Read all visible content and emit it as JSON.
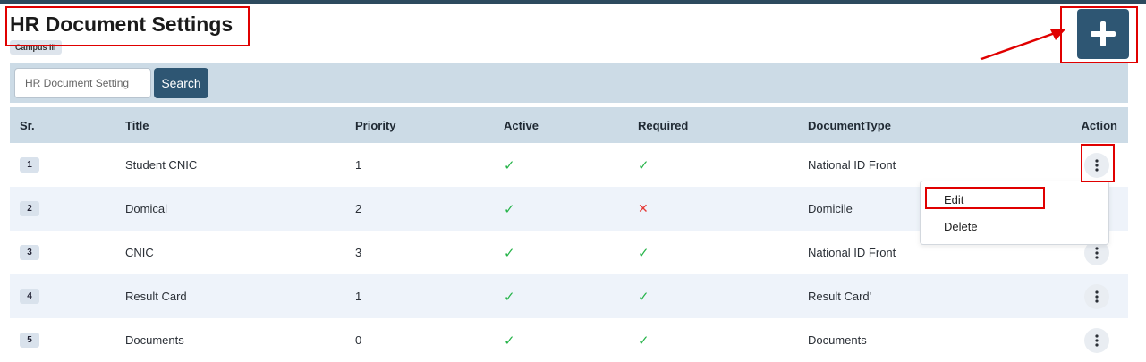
{
  "header": {
    "title": "HR Document Settings",
    "campus_badge": "Campus III"
  },
  "add_button": {
    "icon": "plus-icon"
  },
  "search": {
    "placeholder": "HR Document Setting",
    "value": "",
    "button_label": "Search"
  },
  "table": {
    "columns": {
      "sr": "Sr.",
      "title": "Title",
      "priority": "Priority",
      "active": "Active",
      "required": "Required",
      "document_type": "DocumentType",
      "action": "Action"
    },
    "rows": [
      {
        "sr": "1",
        "title": "Student CNIC",
        "priority": "1",
        "active": true,
        "required": true,
        "document_type": "National ID Front"
      },
      {
        "sr": "2",
        "title": "Domical",
        "priority": "2",
        "active": true,
        "required": false,
        "document_type": "Domicile"
      },
      {
        "sr": "3",
        "title": "CNIC",
        "priority": "3",
        "active": true,
        "required": true,
        "document_type": "National ID Front"
      },
      {
        "sr": "4",
        "title": "Result Card",
        "priority": "1",
        "active": true,
        "required": true,
        "document_type": "Result Card'"
      },
      {
        "sr": "5",
        "title": "Documents",
        "priority": "0",
        "active": true,
        "required": true,
        "document_type": "Documents"
      }
    ]
  },
  "action_menu": {
    "items": [
      {
        "label": "Edit"
      },
      {
        "label": "Delete"
      }
    ]
  },
  "icons": {
    "true": "check-icon",
    "false": "cross-icon",
    "action": "kebab-menu-icon"
  },
  "colors": {
    "primary": "#2e5673",
    "check": "#27b44a",
    "cross": "#e53935",
    "annotation": "#e00000"
  }
}
